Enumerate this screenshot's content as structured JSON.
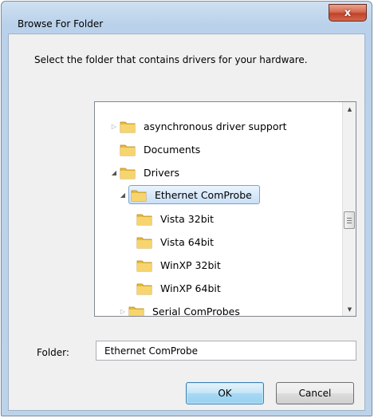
{
  "window": {
    "title": "Browse For Folder",
    "close_glyph": "x"
  },
  "instruction": "Select the folder that contains drivers for your hardware.",
  "tree": {
    "items": [
      {
        "label": "asynchronous driver support",
        "state": "collapsed",
        "level": 2
      },
      {
        "label": "Documents",
        "state": "none",
        "level": 2
      },
      {
        "label": "Drivers",
        "state": "expanded",
        "level": 2
      },
      {
        "label": "Ethernet ComProbe",
        "state": "expanded",
        "level": 3,
        "selected": true
      },
      {
        "label": "Vista 32bit",
        "state": "none",
        "level": 4
      },
      {
        "label": "Vista 64bit",
        "state": "none",
        "level": 4
      },
      {
        "label": "WinXP 32bit",
        "state": "none",
        "level": 4
      },
      {
        "label": "WinXP 64bit",
        "state": "none",
        "level": 4
      },
      {
        "label": "Serial ComProbes",
        "state": "collapsed",
        "level": 3
      }
    ],
    "scroll_position": 0.55
  },
  "folder_field": {
    "label": "Folder:",
    "value": "Ethernet ComProbe"
  },
  "buttons": {
    "ok": "OK",
    "cancel": "Cancel"
  },
  "colors": {
    "folder_yellow": "#f2c94c",
    "selection_border": "#7da2ce",
    "title_bar": "#b9d1ea",
    "close_red": "#c2412a"
  },
  "icons": {
    "folder": "folder-icon",
    "expanded": "triangle-down-right-icon",
    "collapsed": "triangle-right-icon"
  }
}
